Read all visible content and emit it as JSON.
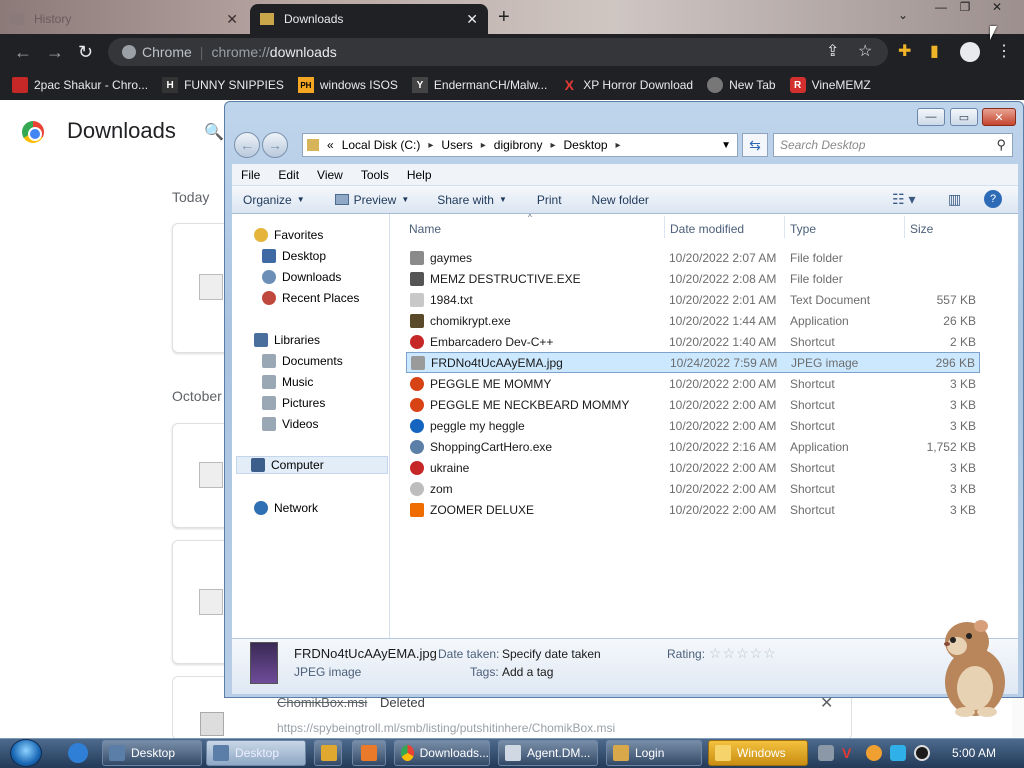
{
  "chrome": {
    "tabs": [
      {
        "title": "History"
      },
      {
        "title": "Downloads"
      }
    ],
    "new_tab": "+",
    "omnibox": {
      "site": "Chrome",
      "protocol": "chrome://",
      "path": "downloads"
    },
    "bookmarks": [
      {
        "label": "2pac Shakur - Chro...",
        "icon": "2pac-icon",
        "color": "#c62828"
      },
      {
        "label": "FUNNY SNIPPIES",
        "icon": "h-icon",
        "color": "#333333",
        "glyph": "H"
      },
      {
        "label": "windows ISOS",
        "icon": "ph-icon",
        "color": "#f5a623",
        "glyph": "PH"
      },
      {
        "label": "EndermanCH/Malw...",
        "icon": "yp-icon",
        "color": "#444444",
        "glyph": "Y"
      },
      {
        "label": "XP Horror Download",
        "icon": "x-icon",
        "color": "#e53935",
        "glyph": "X"
      },
      {
        "label": "New Tab",
        "icon": "newtab-icon",
        "color": "#777777"
      },
      {
        "label": "VineMEMZ",
        "icon": "r-icon",
        "color": "#d32f2f",
        "glyph": "R"
      }
    ]
  },
  "downloads_page": {
    "title": "Downloads",
    "date_today": "Today",
    "date_october": "October",
    "bottom_item": {
      "name": "ChomikBox.msi",
      "status": "Deleted",
      "url": "https://spybeingtroll.ml/smb/listing/putshitinhere/ChomikBox.msi"
    }
  },
  "explorer": {
    "breadcrumb": [
      "Local Disk (C:)",
      "Users",
      "digibrony",
      "Desktop"
    ],
    "search_placeholder": "Search Desktop",
    "menu": [
      "File",
      "Edit",
      "View",
      "Tools",
      "Help"
    ],
    "commands": {
      "organize": "Organize",
      "preview": "Preview",
      "share": "Share with",
      "print": "Print",
      "new_folder": "New folder"
    },
    "nav": {
      "favorites": "Favorites",
      "desktop": "Desktop",
      "downloads": "Downloads",
      "recent": "Recent Places",
      "libraries": "Libraries",
      "documents": "Documents",
      "music": "Music",
      "pictures": "Pictures",
      "videos": "Videos",
      "computer": "Computer",
      "network": "Network"
    },
    "columns": {
      "name": "Name",
      "date": "Date modified",
      "type": "Type",
      "size": "Size"
    },
    "files": [
      {
        "name": "gaymes",
        "date": "10/20/2022 2:07 AM",
        "type": "File folder",
        "size": "",
        "icon_color": "#8a8a8a"
      },
      {
        "name": "MEMZ DESTRUCTIVE.EXE",
        "date": "10/20/2022 2:08 AM",
        "type": "File folder",
        "size": "",
        "icon_color": "#555555"
      },
      {
        "name": "1984.txt",
        "date": "10/20/2022 2:01 AM",
        "type": "Text Document",
        "size": "557 KB",
        "icon_color": "#c8c8c8"
      },
      {
        "name": "chomikrypt.exe",
        "date": "10/20/2022 1:44 AM",
        "type": "Application",
        "size": "26 KB",
        "icon_color": "#5a4a2a"
      },
      {
        "name": "Embarcadero Dev-C++",
        "date": "10/20/2022 1:40 AM",
        "type": "Shortcut",
        "size": "2 KB",
        "icon_color": "#c62828"
      },
      {
        "name": "FRDNo4tUcAAyEMA.jpg",
        "date": "10/24/2022 7:59 AM",
        "type": "JPEG image",
        "size": "296 KB",
        "icon_color": "#9a9a9a"
      },
      {
        "name": "PEGGLE ME MOMMY",
        "date": "10/20/2022 2:00 AM",
        "type": "Shortcut",
        "size": "3 KB",
        "icon_color": "#d84315"
      },
      {
        "name": "PEGGLE ME NECKBEARD MOMMY",
        "date": "10/20/2022 2:00 AM",
        "type": "Shortcut",
        "size": "3 KB",
        "icon_color": "#d84315"
      },
      {
        "name": "peggle my heggle",
        "date": "10/20/2022 2:00 AM",
        "type": "Shortcut",
        "size": "3 KB",
        "icon_color": "#1565c0"
      },
      {
        "name": "ShoppingCartHero.exe",
        "date": "10/20/2022 2:16 AM",
        "type": "Application",
        "size": "1,752 KB",
        "icon_color": "#5c7fa8"
      },
      {
        "name": "ukraine",
        "date": "10/20/2022 2:00 AM",
        "type": "Shortcut",
        "size": "3 KB",
        "icon_color": "#c62828"
      },
      {
        "name": "zom",
        "date": "10/20/2022 2:00 AM",
        "type": "Shortcut",
        "size": "3 KB",
        "icon_color": "#bdbdbd"
      },
      {
        "name": "ZOOMER DELUXE",
        "date": "10/20/2022 2:00 AM",
        "type": "Shortcut",
        "size": "3 KB",
        "icon_color": "#ef6c00"
      }
    ],
    "selected_index": 5,
    "details": {
      "name": "FRDNo4tUcAAyEMA.jpg",
      "type": "JPEG image",
      "date_taken_label": "Date taken:",
      "date_taken_value": "Specify date taken",
      "tags_label": "Tags:",
      "tags_value": "Add a tag",
      "rating_label": "Rating:",
      "rating": 0
    }
  },
  "taskbar": {
    "buttons": [
      {
        "label": "Desktop",
        "icon": "explorer-icon"
      },
      {
        "label": "Desktop",
        "icon": "explorer-icon"
      },
      {
        "label": "Downloads...",
        "icon": "chrome-icon"
      },
      {
        "label": "Agent.DM...",
        "icon": "app-icon"
      },
      {
        "label": "Login",
        "icon": "app-icon"
      },
      {
        "label": "Windows",
        "icon": "windows-icon"
      }
    ],
    "clock": "5:00 AM"
  }
}
